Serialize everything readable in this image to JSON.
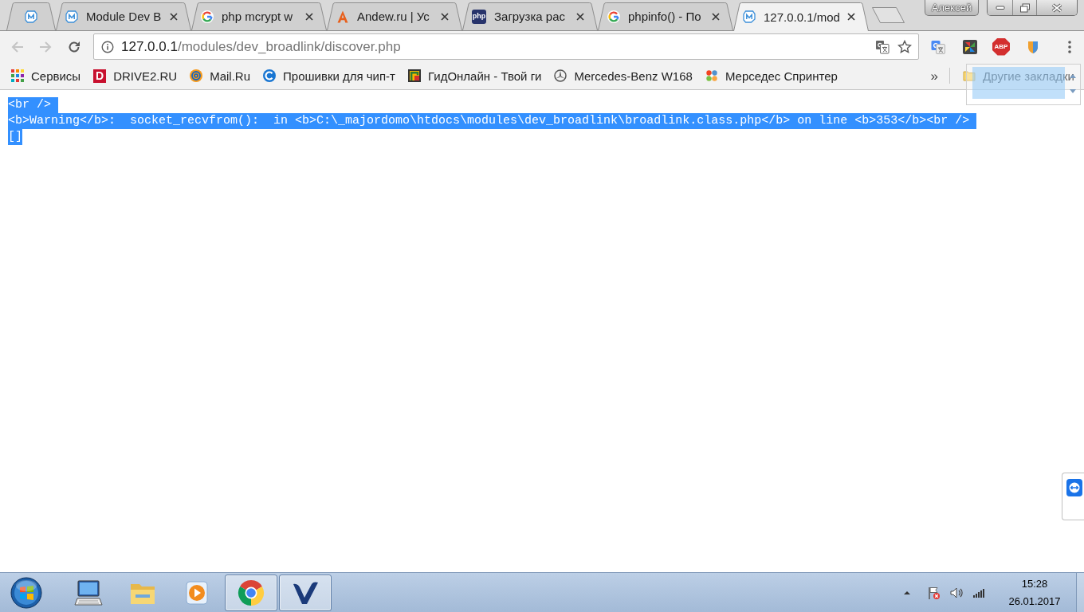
{
  "window": {
    "user": "Алексей"
  },
  "tabs": [
    {
      "pinned": true,
      "selected": false
    },
    {
      "title": "Module Dev B",
      "pinned": false,
      "selected": false
    },
    {
      "title": "php mcrypt w",
      "pinned": false,
      "selected": false
    },
    {
      "title": "Andew.ru | Ус",
      "pinned": false,
      "selected": false
    },
    {
      "title": "Загрузка рас",
      "favicon_text": "php",
      "pinned": false,
      "selected": false
    },
    {
      "title": "phpinfo() - По",
      "pinned": false,
      "selected": false
    },
    {
      "title": "127.0.0.1/mod",
      "pinned": false,
      "selected": true
    }
  ],
  "toolbar": {
    "back": {
      "disabled": true
    },
    "forward": {
      "disabled": true
    },
    "address": {
      "host": "127.0.0.1",
      "path": "/modules/dev_broadlink/discover.php"
    },
    "adblock_label": "ABP"
  },
  "bookmarks": {
    "items": [
      {
        "label": "Сервисы"
      },
      {
        "label": "DRIVE2.RU",
        "favicon_text": "D"
      },
      {
        "label": "Mail.Ru"
      },
      {
        "label": "Прошивки для чип-т"
      },
      {
        "label": "ГидОнлайн - Твой ги"
      },
      {
        "label": "Mercedes-Benz W168"
      },
      {
        "label": "Мерседес Спринтер"
      }
    ],
    "overflow": "»",
    "other": "Другие закладки"
  },
  "page": {
    "selected": true,
    "lines": [
      "<br />",
      "<b>Warning</b>:  socket_recvfrom():  in <b>C:\\_majordomo\\htdocs\\modules\\dev_broadlink\\broadlink.class.php</b> on line <b>353</b><br />",
      "[]"
    ]
  },
  "taskbar": {
    "apps": [
      {
        "open": false
      },
      {
        "open": false
      },
      {
        "open": false
      },
      {
        "open": true
      },
      {
        "open": true
      }
    ],
    "clock": {
      "time": "15:28",
      "date": "26.01.2017"
    }
  }
}
